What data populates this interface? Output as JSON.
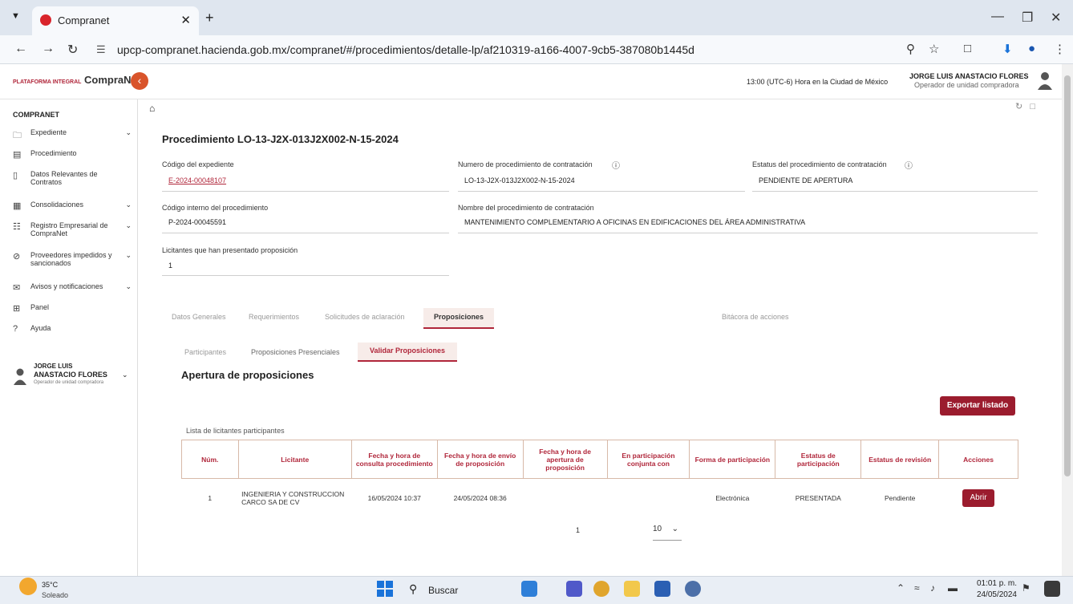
{
  "browser": {
    "tab_title": "Compranet",
    "url": "upcp-compranet.hacienda.gob.mx/compranet/#/procedimientos/detalle-lp/af210319-a166-4007-9cb5-387080b1445d"
  },
  "header": {
    "logo_prefix": "PLATAFORMA INTEGRAL",
    "logo_text": "CompraNet",
    "clock": "13:00 (UTC-6) Hora en la Ciudad de México",
    "user_name": "JORGE LUIS ANASTACIO FLORES",
    "user_role": "Operador de unidad compradora"
  },
  "sidebar": {
    "title": "COMPRANET",
    "items": [
      {
        "label": "Expediente",
        "icon": "folder-icon"
      },
      {
        "label": "Procedimiento",
        "icon": "document-icon"
      },
      {
        "label": "Datos Relevantes de Contratos",
        "icon": "bookmark-icon"
      },
      {
        "label": "Consolidaciones",
        "icon": "archive-icon"
      },
      {
        "label": "Registro Empresarial de CompraNet",
        "icon": "registry-icon"
      },
      {
        "label": "Proveedores impedidos y sancionados",
        "icon": "block-icon"
      },
      {
        "label": "Avisos y notificaciones",
        "icon": "mail-icon"
      },
      {
        "label": "Panel",
        "icon": "grid-icon"
      },
      {
        "label": "Ayuda",
        "icon": "help-icon"
      }
    ],
    "user_name_line1": "JORGE LUIS",
    "user_name_line2": "ANASTACIO FLORES",
    "user_role": "Operador de unidad compradora"
  },
  "procedure": {
    "title": "Procedimiento LO-13-J2X-013J2X002-N-15-2024",
    "exp_code_label": "Código del expediente",
    "exp_code": "E-2024-00048107",
    "num_label": "Numero de procedimiento de contratación",
    "num_value": "LO-13-J2X-013J2X002-N-15-2024",
    "status_label": "Estatus del procedimiento de contratación",
    "status_value": "PENDIENTE DE APERTURA",
    "internal_label": "Código interno del procedimiento",
    "internal_value": "P-2024-00045591",
    "name_label": "Nombre del procedimiento de contratación",
    "name_value": "MANTENIMIENTO COMPLEMENTARIO A OFICINAS EN EDIFICACIONES DEL ÁREA ADMINISTRATIVA",
    "bidders_label": "Licitantes que han presentado proposición",
    "bidders_value": "1"
  },
  "tabs": {
    "t1": "Datos Generales",
    "t2": "Requerimientos",
    "t3": "Solicitudes de aclaración",
    "t4": "Proposiciones",
    "t5": "Bitácora de acciones"
  },
  "subtabs": {
    "s1": "Participantes",
    "s2": "Proposiciones Presenciales",
    "s3": "Validar Proposiciones"
  },
  "section": {
    "title": "Apertura de proposiciones",
    "export_label": "Exportar listado",
    "list_caption": "Lista de licitantes participantes"
  },
  "table": {
    "headers": [
      "Núm.",
      "Licitante",
      "Fecha y hora de consulta procedimiento",
      "Fecha y hora de envío de proposición",
      "Fecha y hora de apertura de proposición",
      "En participación conjunta con",
      "Forma de participación",
      "Estatus de participación",
      "Estatus de revisión",
      "Acciones"
    ],
    "rows": [
      {
        "num": "1",
        "bidder": "INGENIERIA Y CONSTRUCCION CARCO SA DE CV",
        "consult": "16/05/2024 10:37",
        "sent": "24/05/2024 08:36",
        "opened": "",
        "joint": "",
        "form": "Electrónica",
        "part_status": "PRESENTADA",
        "rev_status": "Pendiente",
        "action": "Abrir"
      }
    ]
  },
  "pager": {
    "page": "1",
    "size": "10"
  },
  "taskbar": {
    "temp": "35°C",
    "condition": "Soleado",
    "search": "Buscar",
    "time": "01:01 p. m.",
    "date": "24/05/2024"
  }
}
